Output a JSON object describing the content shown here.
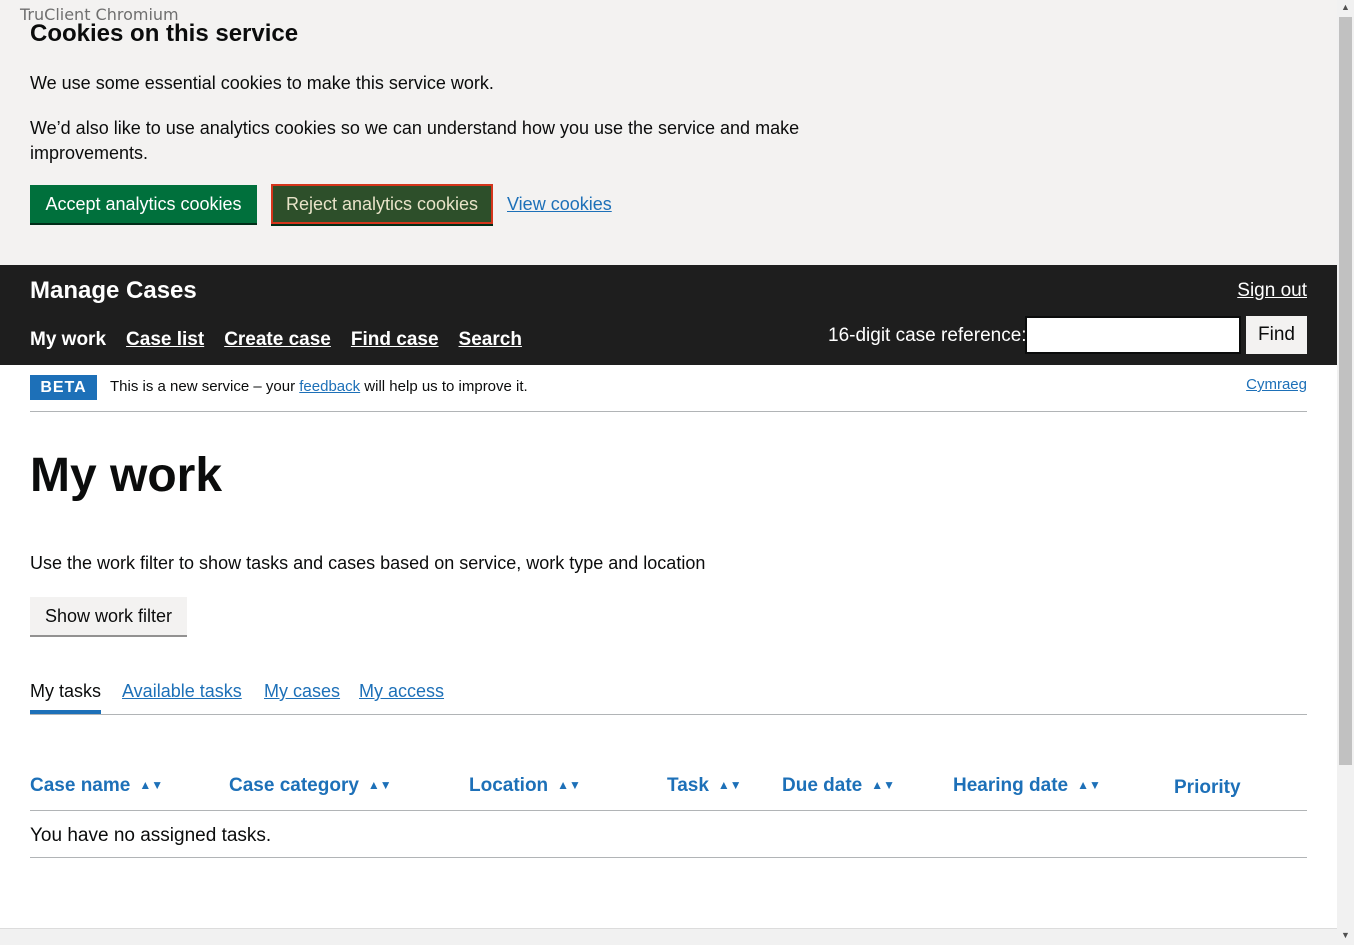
{
  "browser": {
    "label": "TruClient Chromium"
  },
  "cookie_banner": {
    "title": "Cookies on this service",
    "para1": "We use some essential cookies to make this service work.",
    "para2": "We’d also like to use analytics cookies so we can understand how you use the service and make improvements.",
    "accept_label": "Accept analytics cookies",
    "reject_label": "Reject analytics cookies",
    "view_label": "View cookies"
  },
  "header": {
    "brand": "Manage Cases",
    "sign_out": "Sign out",
    "nav": [
      "My work",
      "Case list",
      "Create case",
      "Find case",
      "Search"
    ],
    "case_ref_label": "16-digit case reference:",
    "case_ref_value": "",
    "find_label": "Find"
  },
  "beta": {
    "tag": "BETA",
    "msg_before": "This is a new service – your ",
    "feedback": "feedback",
    "msg_after": " will help us to improve it.",
    "language": "Cymraeg"
  },
  "main": {
    "title": "My work",
    "intro": "Use the work filter to show tasks and cases based on service, work type and location",
    "filter_button": "Show work filter",
    "tabs": [
      "My tasks",
      "Available tasks",
      "My cases",
      "My access"
    ],
    "columns": [
      "Case name",
      "Case category",
      "Location",
      "Task",
      "Due date",
      "Hearing date",
      "Priority"
    ],
    "empty_message": "You have no assigned tasks."
  },
  "colors": {
    "accent": "#1d70b8",
    "accept_green": "#00703c",
    "header_bg": "#1e1e1e"
  }
}
